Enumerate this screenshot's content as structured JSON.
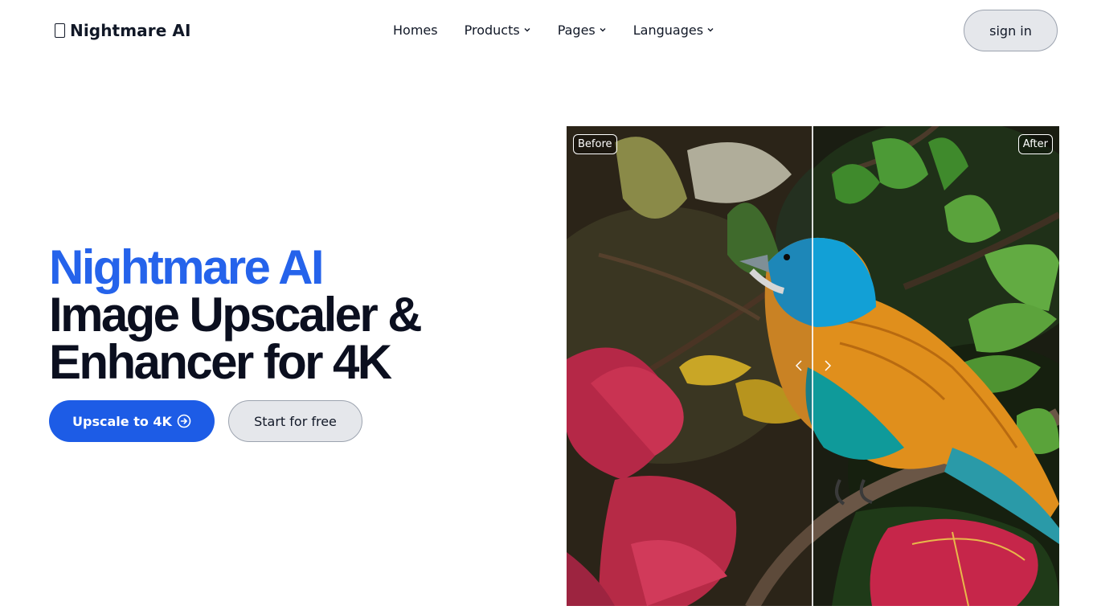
{
  "header": {
    "brand": "Nightmare AI",
    "brand_icon": "logo-glyph-icon",
    "nav": [
      {
        "label": "Homes",
        "has_dropdown": false
      },
      {
        "label": "Products",
        "has_dropdown": true
      },
      {
        "label": "Pages",
        "has_dropdown": true
      },
      {
        "label": "Languages",
        "has_dropdown": true
      }
    ],
    "signin_label": "sign in"
  },
  "hero": {
    "title_accent": "Nightmare AI",
    "title_line2": "Image Upscaler &",
    "title_line3": "Enhancer for 4K",
    "primary_cta": "Upscale to 4K",
    "primary_cta_icon": "arrow-right-circle-icon",
    "secondary_cta": "Start for free"
  },
  "compare": {
    "before_label": "Before",
    "after_label": "After",
    "slider_position": 0.5
  },
  "colors": {
    "accent": "#2563eb",
    "primary_button": "#1d5ce6",
    "secondary_button": "#e5e7eb",
    "text": "#111827"
  }
}
